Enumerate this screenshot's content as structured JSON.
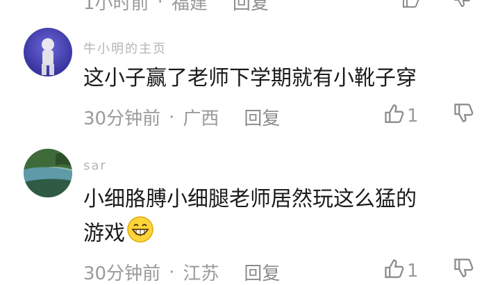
{
  "top_partial": {
    "time": "1小时前",
    "location": "福建",
    "reply": "回复"
  },
  "comments": [
    {
      "username": "牛小明的主页",
      "text": "这小子赢了老师下学期就有小靴子穿",
      "time": "30分钟前",
      "location": "广西",
      "reply": "回复",
      "likes": "1"
    },
    {
      "username": "sar",
      "text_line1": "小细胳膊小细腿老师居然玩这么猛的",
      "text_line2": "游戏",
      "time": "30分钟前",
      "location": "江苏",
      "reply": "回复",
      "likes": "1"
    }
  ]
}
